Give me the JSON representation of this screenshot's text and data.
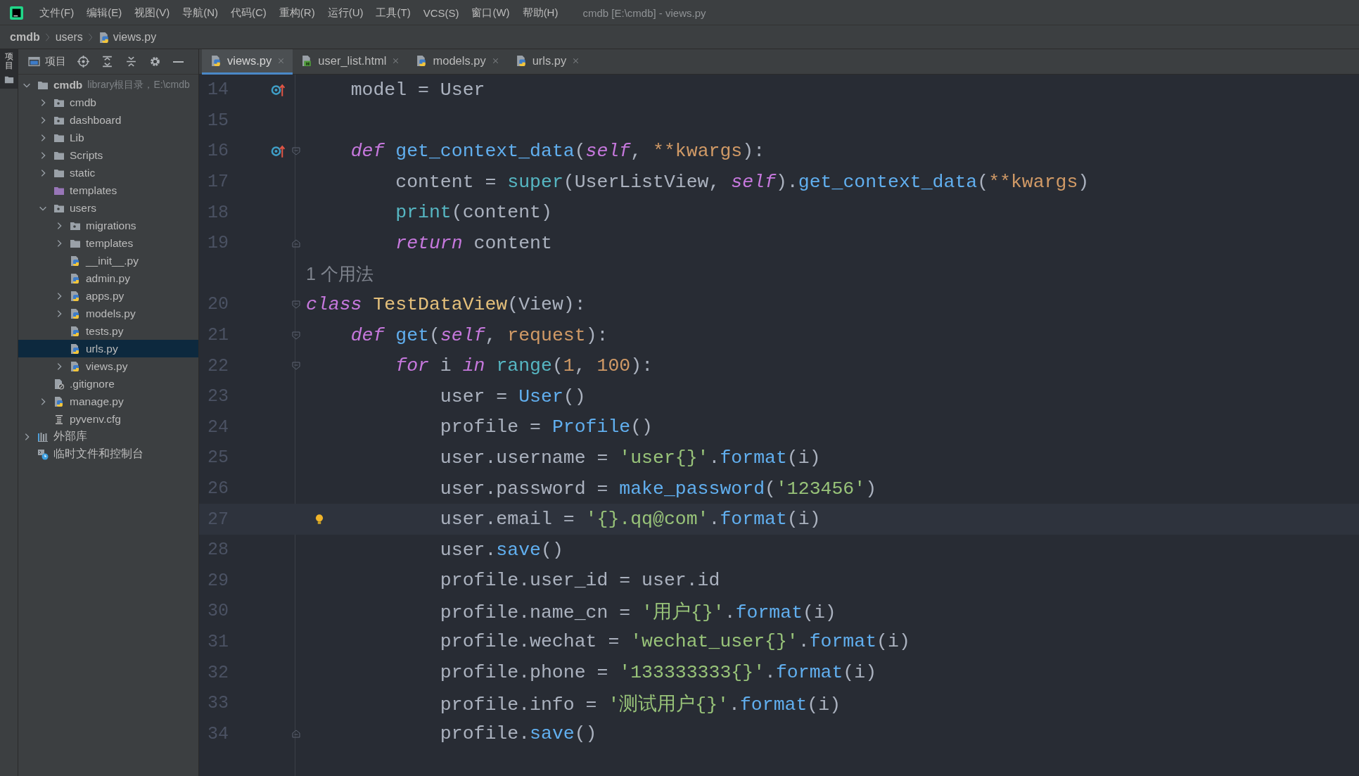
{
  "menu_bar": {
    "items": [
      "文件(F)",
      "编辑(E)",
      "视图(V)",
      "导航(N)",
      "代码(C)",
      "重构(R)",
      "运行(U)",
      "工具(T)",
      "VCS(S)",
      "窗口(W)",
      "帮助(H)"
    ],
    "title": "cmdb [E:\\cmdb] - views.py"
  },
  "breadcrumb": [
    {
      "label": "cmdb",
      "kind": "project"
    },
    {
      "label": "users",
      "kind": "folder"
    },
    {
      "label": "views.py",
      "kind": "python"
    }
  ],
  "tool_stripe": {
    "label": "项目"
  },
  "project_panel": {
    "title": "项目",
    "tree": [
      {
        "label": "cmdb",
        "hint": "library根目录，E:\\cmdb",
        "kind": "folder",
        "expanded": true,
        "selected": false,
        "children": [
          {
            "label": "cmdb",
            "kind": "module",
            "expanded": false,
            "selected": false
          },
          {
            "label": "dashboard",
            "kind": "module",
            "expanded": false,
            "selected": false
          },
          {
            "label": "Lib",
            "kind": "folder",
            "expanded": false,
            "selected": false
          },
          {
            "label": "Scripts",
            "kind": "folder",
            "expanded": false,
            "selected": false
          },
          {
            "label": "static",
            "kind": "folder",
            "expanded": false,
            "selected": false
          },
          {
            "label": "templates",
            "kind": "resource",
            "selected": false
          },
          {
            "label": "users",
            "kind": "module",
            "expanded": true,
            "selected": false,
            "children": [
              {
                "label": "migrations",
                "kind": "module",
                "expanded": false,
                "selected": false
              },
              {
                "label": "templates",
                "kind": "folder",
                "expanded": false,
                "selected": false
              },
              {
                "label": "__init__.py",
                "kind": "python",
                "selected": false
              },
              {
                "label": "admin.py",
                "kind": "python",
                "selected": false
              },
              {
                "label": "apps.py",
                "kind": "python",
                "expanded": false,
                "selected": false
              },
              {
                "label": "models.py",
                "kind": "python",
                "expanded": false,
                "selected": false
              },
              {
                "label": "tests.py",
                "kind": "python",
                "selected": false
              },
              {
                "label": "urls.py",
                "kind": "python",
                "selected": true
              },
              {
                "label": "views.py",
                "kind": "python",
                "expanded": false,
                "selected": false
              }
            ]
          },
          {
            "label": ".gitignore",
            "kind": "ignored",
            "selected": false
          },
          {
            "label": "manage.py",
            "kind": "python",
            "expanded": false,
            "selected": false
          },
          {
            "label": "pyvenv.cfg",
            "kind": "config",
            "selected": false
          }
        ]
      },
      {
        "label": "外部库",
        "kind": "library",
        "expanded": false,
        "selected": false
      },
      {
        "label": "临时文件和控制台",
        "kind": "scratch",
        "selected": false
      }
    ]
  },
  "tabs": [
    {
      "label": "views.py",
      "kind": "python",
      "selected": true
    },
    {
      "label": "user_list.html",
      "kind": "html",
      "selected": false
    },
    {
      "label": "models.py",
      "kind": "python",
      "selected": false
    },
    {
      "label": "urls.py",
      "kind": "python",
      "selected": false
    }
  ],
  "editor": {
    "lines": [
      {
        "kind": "code",
        "number": "14",
        "current": false,
        "gutter": [
          {
            "kind": "override"
          }
        ],
        "tokens": [
          {
            "text": "    model = User",
            "kind": "plain"
          }
        ]
      },
      {
        "kind": "code",
        "number": "15",
        "current": false
      },
      {
        "kind": "code",
        "number": "16",
        "current": false,
        "gutter": [
          {
            "kind": "override"
          },
          {
            "kind": "fold_open"
          }
        ],
        "tokens": [
          {
            "text": "    def ",
            "kind": "keyword"
          },
          {
            "text": "get_context_data",
            "kind": "func"
          },
          {
            "text": "(",
            "kind": "plain"
          },
          {
            "text": "self",
            "kind": "self"
          },
          {
            "text": ", ",
            "kind": "plain"
          },
          {
            "text": "**kwargs",
            "kind": "param"
          },
          {
            "text": "):",
            "kind": "plain"
          }
        ]
      },
      {
        "kind": "code",
        "number": "17",
        "current": false,
        "tokens": [
          {
            "text": "        content = ",
            "kind": "plain"
          },
          {
            "text": "super",
            "kind": "builtin"
          },
          {
            "text": "(UserListView, ",
            "kind": "plain"
          },
          {
            "text": "self",
            "kind": "self"
          },
          {
            "text": ").",
            "kind": "plain"
          },
          {
            "text": "get_context_data",
            "kind": "func"
          },
          {
            "text": "(",
            "kind": "plain"
          },
          {
            "text": "**kwargs",
            "kind": "param"
          },
          {
            "text": ")",
            "kind": "plain"
          }
        ]
      },
      {
        "kind": "code",
        "number": "18",
        "current": false,
        "tokens": [
          {
            "text": "        print",
            "kind": "builtin"
          },
          {
            "text": "(content)",
            "kind": "plain"
          }
        ]
      },
      {
        "kind": "code",
        "number": "19",
        "current": false,
        "gutter": [
          {
            "kind": "fold_close"
          }
        ],
        "tokens": [
          {
            "text": "        return",
            "kind": "keyword"
          },
          {
            "text": " content",
            "kind": "plain"
          }
        ]
      },
      {
        "kind": "hint",
        "text": "1 个用法"
      },
      {
        "kind": "code",
        "number": "20",
        "current": false,
        "gutter": [
          {
            "kind": "fold_open"
          }
        ],
        "tokens": [
          {
            "text": "class ",
            "kind": "keyword"
          },
          {
            "text": "TestDataView",
            "kind": "classname"
          },
          {
            "text": "(View):",
            "kind": "plain"
          }
        ]
      },
      {
        "kind": "code",
        "number": "21",
        "current": false,
        "gutter": [
          {
            "kind": "fold_open"
          }
        ],
        "tokens": [
          {
            "text": "    def ",
            "kind": "keyword"
          },
          {
            "text": "get",
            "kind": "func"
          },
          {
            "text": "(",
            "kind": "plain"
          },
          {
            "text": "self",
            "kind": "self"
          },
          {
            "text": ", ",
            "kind": "plain"
          },
          {
            "text": "request",
            "kind": "param"
          },
          {
            "text": "):",
            "kind": "plain"
          }
        ]
      },
      {
        "kind": "code",
        "number": "22",
        "current": false,
        "gutter": [
          {
            "kind": "fold_open"
          }
        ],
        "tokens": [
          {
            "text": "        for",
            "kind": "keyword"
          },
          {
            "text": " i ",
            "kind": "plain"
          },
          {
            "text": "in ",
            "kind": "keyword"
          },
          {
            "text": "range",
            "kind": "builtin"
          },
          {
            "text": "(",
            "kind": "plain"
          },
          {
            "text": "1",
            "kind": "number"
          },
          {
            "text": ", ",
            "kind": "plain"
          },
          {
            "text": "100",
            "kind": "number"
          },
          {
            "text": "):",
            "kind": "plain"
          }
        ]
      },
      {
        "kind": "code",
        "number": "23",
        "current": false,
        "tokens": [
          {
            "text": "            user = ",
            "kind": "plain"
          },
          {
            "text": "User",
            "kind": "func"
          },
          {
            "text": "()",
            "kind": "plain"
          }
        ]
      },
      {
        "kind": "code",
        "number": "24",
        "current": false,
        "tokens": [
          {
            "text": "            profile = ",
            "kind": "plain"
          },
          {
            "text": "Profile",
            "kind": "func"
          },
          {
            "text": "()",
            "kind": "plain"
          }
        ]
      },
      {
        "kind": "code",
        "number": "25",
        "current": false,
        "tokens": [
          {
            "text": "            user.username = ",
            "kind": "plain"
          },
          {
            "text": "'user{}'",
            "kind": "string"
          },
          {
            "text": ".",
            "kind": "plain"
          },
          {
            "text": "format",
            "kind": "func"
          },
          {
            "text": "(i)",
            "kind": "plain"
          }
        ]
      },
      {
        "kind": "code",
        "number": "26",
        "current": false,
        "tokens": [
          {
            "text": "            user.password = ",
            "kind": "plain"
          },
          {
            "text": "make_password",
            "kind": "func"
          },
          {
            "text": "(",
            "kind": "plain"
          },
          {
            "text": "'123456'",
            "kind": "string"
          },
          {
            "text": ")",
            "kind": "plain"
          }
        ]
      },
      {
        "kind": "code",
        "number": "27",
        "current": true,
        "gutter": [
          {
            "kind": "bulb"
          }
        ],
        "tokens": [
          {
            "text": "            user.email = ",
            "kind": "plain"
          },
          {
            "text": "'{}.qq@com'",
            "kind": "string"
          },
          {
            "text": ".",
            "kind": "plain"
          },
          {
            "text": "format",
            "kind": "func"
          },
          {
            "text": "(i)",
            "kind": "plain"
          }
        ]
      },
      {
        "kind": "code",
        "number": "28",
        "current": false,
        "tokens": [
          {
            "text": "            user.",
            "kind": "plain"
          },
          {
            "text": "save",
            "kind": "func"
          },
          {
            "text": "()",
            "kind": "plain"
          }
        ]
      },
      {
        "kind": "code",
        "number": "29",
        "current": false,
        "tokens": [
          {
            "text": "            profile.user_id = user.id",
            "kind": "plain"
          }
        ]
      },
      {
        "kind": "code",
        "number": "30",
        "current": false,
        "tokens": [
          {
            "text": "            profile.name_cn = ",
            "kind": "plain"
          },
          {
            "text": "'用户{}'",
            "kind": "string"
          },
          {
            "text": ".",
            "kind": "plain"
          },
          {
            "text": "format",
            "kind": "func"
          },
          {
            "text": "(i)",
            "kind": "plain"
          }
        ]
      },
      {
        "kind": "code",
        "number": "31",
        "current": false,
        "tokens": [
          {
            "text": "            profile.wechat = ",
            "kind": "plain"
          },
          {
            "text": "'wechat_user{}'",
            "kind": "string"
          },
          {
            "text": ".",
            "kind": "plain"
          },
          {
            "text": "format",
            "kind": "func"
          },
          {
            "text": "(i)",
            "kind": "plain"
          }
        ]
      },
      {
        "kind": "code",
        "number": "32",
        "current": false,
        "tokens": [
          {
            "text": "            profile.phone = ",
            "kind": "plain"
          },
          {
            "text": "'133333333{}'",
            "kind": "string"
          },
          {
            "text": ".",
            "kind": "plain"
          },
          {
            "text": "format",
            "kind": "func"
          },
          {
            "text": "(i)",
            "kind": "plain"
          }
        ]
      },
      {
        "kind": "code",
        "number": "33",
        "current": false,
        "tokens": [
          {
            "text": "            profile.info = ",
            "kind": "plain"
          },
          {
            "text": "'测试用户{}'",
            "kind": "string"
          },
          {
            "text": ".",
            "kind": "plain"
          },
          {
            "text": "format",
            "kind": "func"
          },
          {
            "text": "(i)",
            "kind": "plain"
          }
        ]
      },
      {
        "kind": "code",
        "number": "34",
        "current": false,
        "gutter": [
          {
            "kind": "fold_close"
          }
        ],
        "tokens": [
          {
            "text": "            profile.",
            "kind": "plain"
          },
          {
            "text": "save",
            "kind": "func"
          },
          {
            "text": "()",
            "kind": "plain"
          }
        ]
      }
    ]
  }
}
